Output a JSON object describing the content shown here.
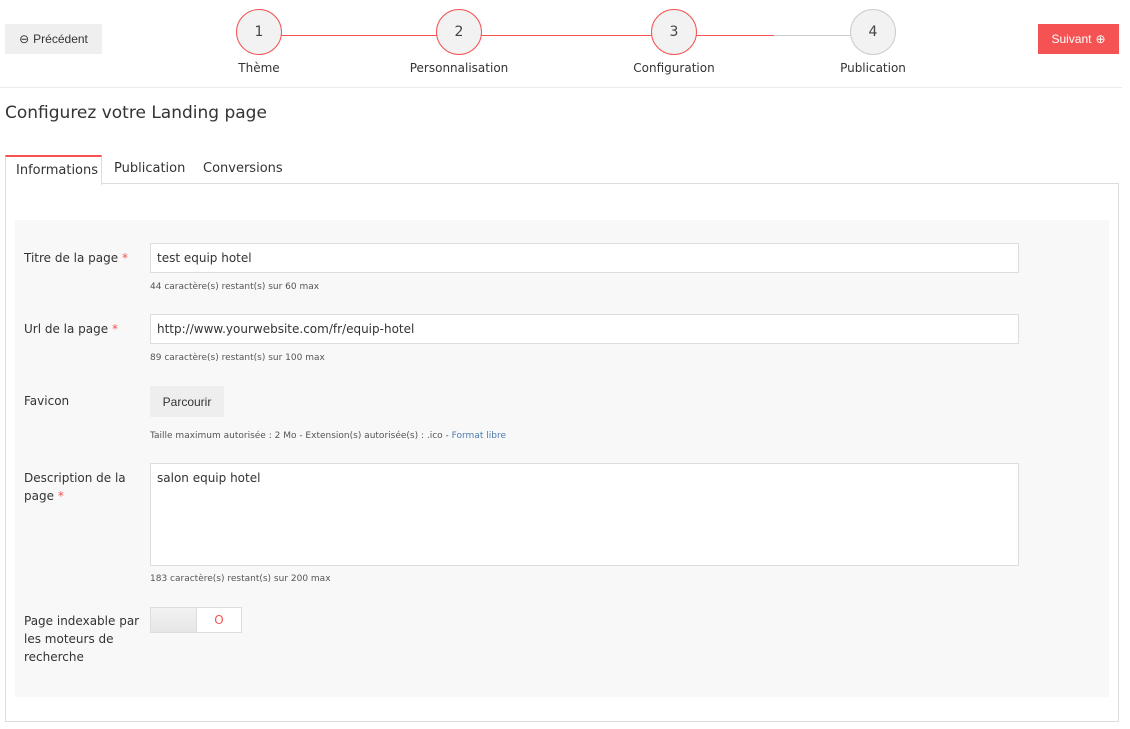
{
  "nav": {
    "prev_label": "Précédent",
    "next_label": "Suivant"
  },
  "steps": [
    {
      "num": "1",
      "label": "Thème"
    },
    {
      "num": "2",
      "label": "Personnalisation"
    },
    {
      "num": "3",
      "label": "Configuration"
    },
    {
      "num": "4",
      "label": "Publication"
    }
  ],
  "title": "Configurez votre Landing page",
  "tabs": [
    "Informations",
    "Publication",
    "Conversions"
  ],
  "form": {
    "required_mark": "*",
    "page_title": {
      "label": "Titre de la page",
      "value": "test equip hotel",
      "help": "44 caractère(s) restant(s) sur 60 max"
    },
    "url": {
      "label": "Url de la page",
      "value": "http://www.yourwebsite.com/fr/equip-hotel",
      "help": "89 caractère(s) restant(s) sur 100 max"
    },
    "favicon": {
      "label": "Favicon",
      "button": "Parcourir",
      "help": "Taille maximum autorisée : 2 Mo - Extension(s) autorisée(s) : .ico - ",
      "help_link": "Format libre"
    },
    "description": {
      "label": "Description de la page",
      "value": "salon equip hotel",
      "help": "183 caractère(s) restant(s) sur 200 max"
    },
    "indexable": {
      "label": "Page indexable par les moteurs de recherche",
      "toggle_text": "O"
    }
  },
  "colors": {
    "accent": "#f55353"
  }
}
